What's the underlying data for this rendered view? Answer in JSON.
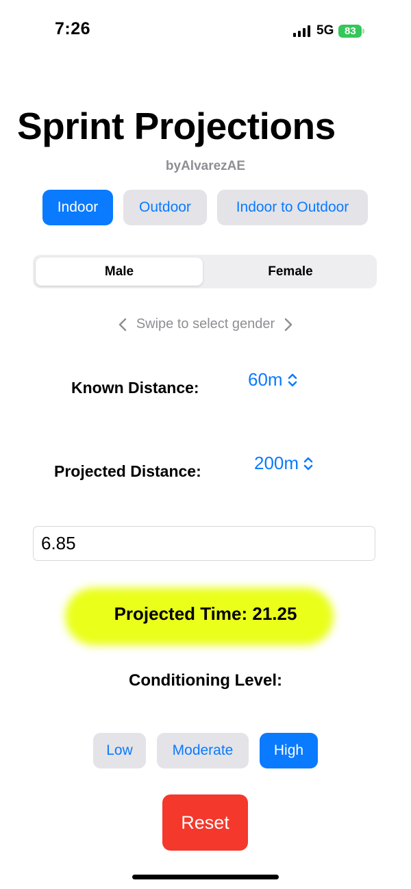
{
  "status": {
    "time": "7:26",
    "network": "5G",
    "battery": "83",
    "icons": [
      "signal-bars-icon",
      "battery-charging-icon"
    ]
  },
  "app": {
    "title": "Sprint Projections",
    "byline": "byAlvarezAE"
  },
  "venue_tabs": [
    {
      "label": "Indoor",
      "selected": true
    },
    {
      "label": "Outdoor",
      "selected": false
    },
    {
      "label": "Indoor to Outdoor",
      "selected": false
    }
  ],
  "gender": {
    "options": [
      "Male",
      "Female"
    ],
    "selected": "Male",
    "hint": "Swipe to select gender"
  },
  "known_distance": {
    "label": "Known Distance:",
    "value": "60m"
  },
  "projected_distance": {
    "label": "Projected Distance:",
    "value": "200m"
  },
  "time_input": {
    "value": "6.85"
  },
  "result": {
    "text": "Projected Time: 21.25"
  },
  "conditioning": {
    "label": "Conditioning Level:",
    "options": [
      {
        "label": "Low",
        "selected": false
      },
      {
        "label": "Moderate",
        "selected": false
      },
      {
        "label": "High",
        "selected": true
      }
    ]
  },
  "reset_label": "Reset",
  "colors": {
    "accent": "#0a7aff",
    "danger": "#f4382c",
    "highlight": "#eaff1a",
    "battery": "#34c759"
  }
}
